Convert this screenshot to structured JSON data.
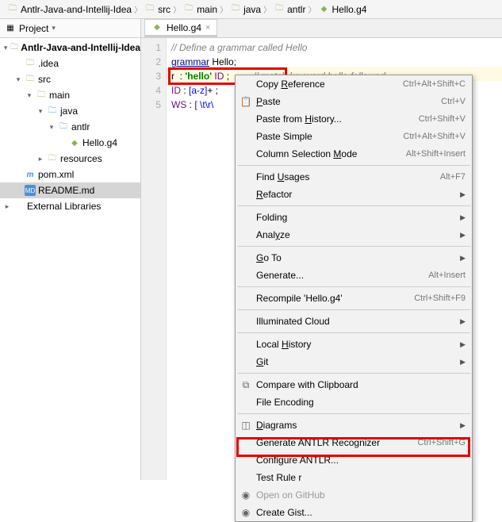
{
  "breadcrumb": [
    "Antlr-Java-and-Intellij-Idea",
    "src",
    "main",
    "java",
    "antlr",
    "Hello.g4"
  ],
  "sidebar": {
    "title": "Project",
    "items": [
      {
        "label": "Antlr-Java-and-Intellij-Idea",
        "indent": 0,
        "arrow": "▾",
        "icon": "folder",
        "bold": true
      },
      {
        "label": ".idea",
        "indent": 1,
        "arrow": "",
        "icon": "folder"
      },
      {
        "label": "src",
        "indent": 1,
        "arrow": "▾",
        "icon": "folder"
      },
      {
        "label": "main",
        "indent": 2,
        "arrow": "▾",
        "icon": "folder"
      },
      {
        "label": "java",
        "indent": 3,
        "arrow": "▾",
        "icon": "folder-blue"
      },
      {
        "label": "antlr",
        "indent": 4,
        "arrow": "▾",
        "icon": "folder-blue"
      },
      {
        "label": "Hello.g4",
        "indent": 5,
        "arrow": "",
        "icon": "g4"
      },
      {
        "label": "resources",
        "indent": 3,
        "arrow": "▸",
        "icon": "folder"
      },
      {
        "label": "pom.xml",
        "indent": 1,
        "arrow": "",
        "icon": "pom"
      },
      {
        "label": "README.md",
        "indent": 1,
        "arrow": "",
        "icon": "md",
        "selected": true
      },
      {
        "label": "External Libraries",
        "indent": 0,
        "arrow": "▸",
        "icon": ""
      }
    ]
  },
  "tab": {
    "label": "Hello.g4"
  },
  "code": {
    "lines": [
      {
        "n": "1",
        "html": "<span class='comment'>// Define a grammar called Hello</span>"
      },
      {
        "n": "2",
        "html": "<span class='kw'>grammar</span> <span class='rule'>Hello</span>;"
      },
      {
        "n": "3",
        "html": "<span class='rule'>r</span>  : <span class='str'>'hello'</span> <span class='tok'>ID</span> ;         <span class='comment'>// match keyword hello followed</span>",
        "hl": true
      },
      {
        "n": "4",
        "html": "<span class='tok'>ID</span> : <span class='chset'>[a-z]</span>+ ;             <span class='comment'>//                        fiers</span>"
      },
      {
        "n": "5",
        "html": "<span class='tok'>WS</span> : <span class='chset'>[ \\t\\r\\</span>              <span class='comment'>//                        ines</span>"
      }
    ]
  },
  "menu": [
    {
      "type": "item",
      "label": "Copy Reference",
      "shortcut": "Ctrl+Alt+Shift+C",
      "u": 5
    },
    {
      "type": "item",
      "label": "Paste",
      "shortcut": "Ctrl+V",
      "icon": "📋",
      "u": 0
    },
    {
      "type": "item",
      "label": "Paste from History...",
      "shortcut": "Ctrl+Shift+V",
      "u": 11
    },
    {
      "type": "item",
      "label": "Paste Simple",
      "shortcut": "Ctrl+Alt+Shift+V"
    },
    {
      "type": "item",
      "label": "Column Selection Mode",
      "shortcut": "Alt+Shift+Insert",
      "u": 17
    },
    {
      "type": "sep"
    },
    {
      "type": "item",
      "label": "Find Usages",
      "shortcut": "Alt+F7",
      "u": 5
    },
    {
      "type": "item",
      "label": "Refactor",
      "sub": true,
      "u": 0
    },
    {
      "type": "sep"
    },
    {
      "type": "item",
      "label": "Folding",
      "sub": true
    },
    {
      "type": "item",
      "label": "Analyze",
      "sub": true,
      "u": 4
    },
    {
      "type": "sep"
    },
    {
      "type": "item",
      "label": "Go To",
      "sub": true,
      "u": 0
    },
    {
      "type": "item",
      "label": "Generate...",
      "shortcut": "Alt+Insert"
    },
    {
      "type": "sep"
    },
    {
      "type": "item",
      "label": "Recompile 'Hello.g4'",
      "shortcut": "Ctrl+Shift+F9"
    },
    {
      "type": "sep"
    },
    {
      "type": "item",
      "label": "Illuminated Cloud",
      "sub": true
    },
    {
      "type": "sep"
    },
    {
      "type": "item",
      "label": "Local History",
      "sub": true,
      "u": 6
    },
    {
      "type": "item",
      "label": "Git",
      "sub": true,
      "u": 0
    },
    {
      "type": "sep"
    },
    {
      "type": "item",
      "label": "Compare with Clipboard",
      "icon": "⧉"
    },
    {
      "type": "item",
      "label": "File Encoding"
    },
    {
      "type": "sep"
    },
    {
      "type": "item",
      "label": "Diagrams",
      "sub": true,
      "icon": "◫",
      "u": 0
    },
    {
      "type": "item",
      "label": "Generate ANTLR Recognizer",
      "shortcut": "Ctrl+Shift+G"
    },
    {
      "type": "item",
      "label": "Configure ANTLR..."
    },
    {
      "type": "item",
      "label": "Test Rule r"
    },
    {
      "type": "item",
      "label": "Open on GitHub",
      "icon": "◉",
      "disabled": true
    },
    {
      "type": "item",
      "label": "Create Gist...",
      "icon": "◉"
    }
  ]
}
